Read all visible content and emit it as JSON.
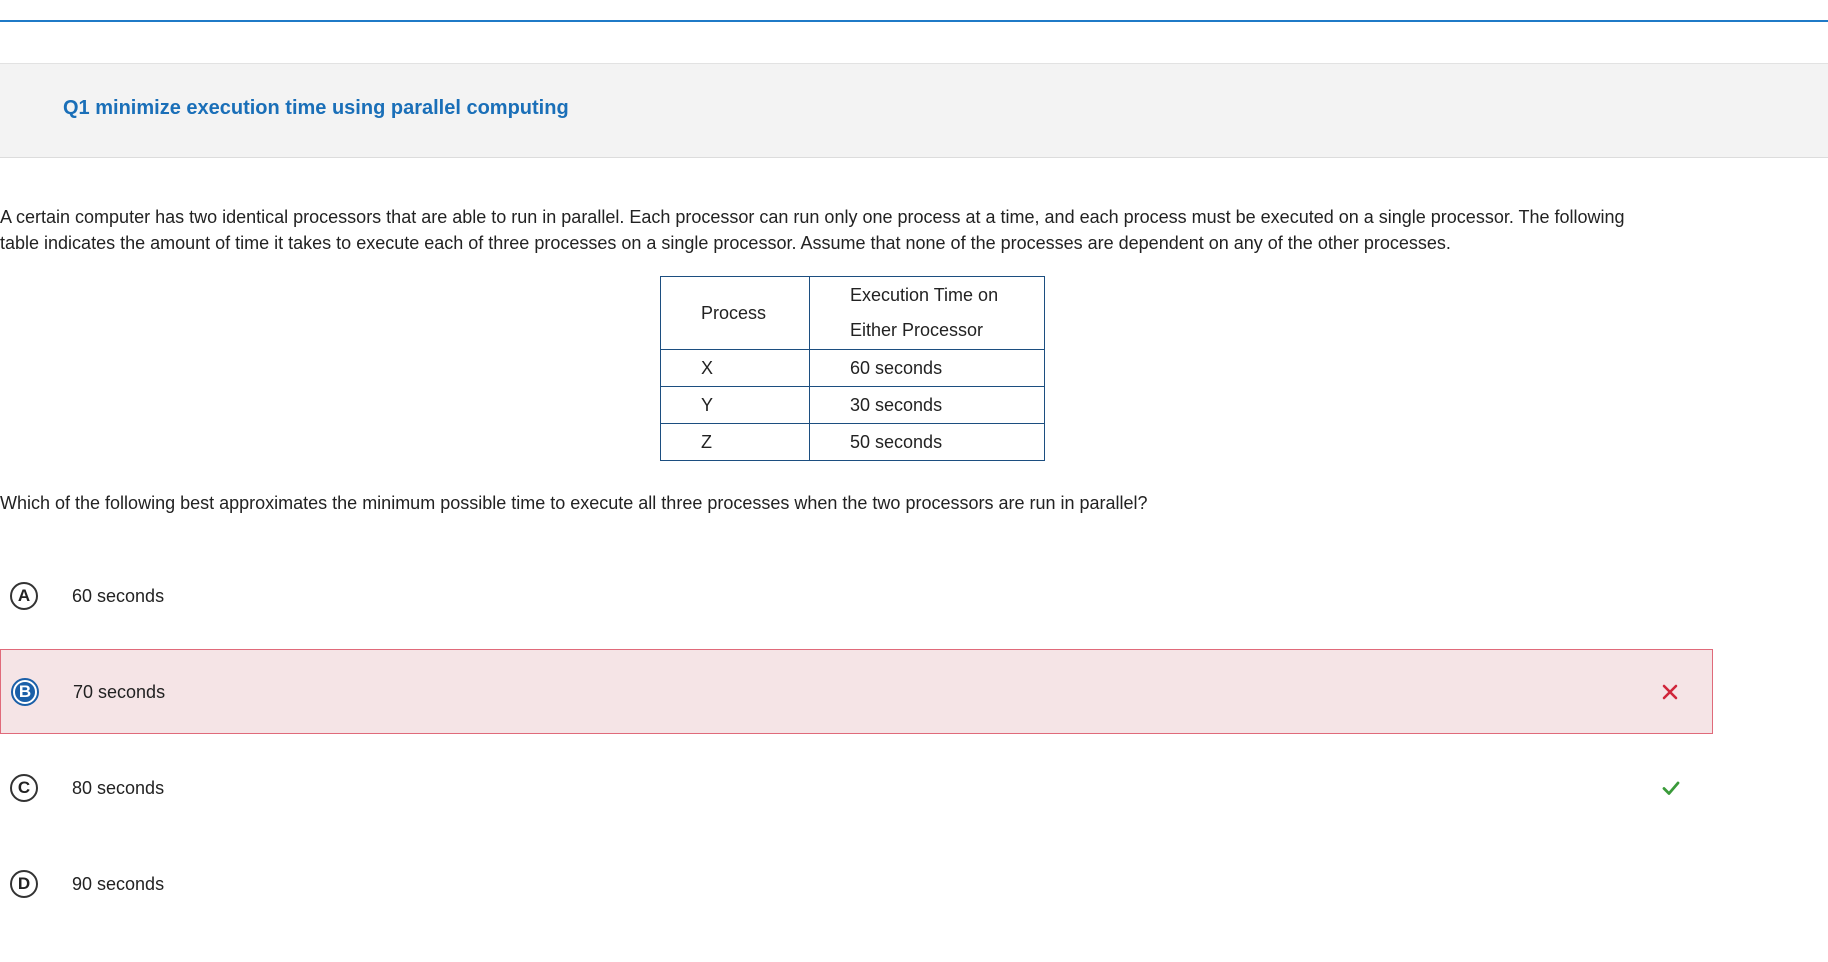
{
  "question": {
    "title": "Q1 minimize execution time using parallel computing",
    "prompt_line1": "A certain computer has two identical processors that are able to run in parallel. Each processor can run only one process at a time, and each process must be executed on a single processor. The following",
    "prompt_line2": "table indicates the amount of time it takes to execute each of three processes on a single processor. Assume that none of the processes are dependent on any of the other processes.",
    "stem": "Which of the following best approximates the minimum possible time to execute all three processes when the two processors are run in parallel?"
  },
  "table": {
    "header_process": "Process",
    "header_exec_line1": "Execution Time on",
    "header_exec_line2": "Either Processor",
    "rows": [
      {
        "process": "X",
        "time": "60 seconds"
      },
      {
        "process": "Y",
        "time": "30 seconds"
      },
      {
        "process": "Z",
        "time": "50 seconds"
      }
    ]
  },
  "choices": [
    {
      "letter": "A",
      "text": "60 seconds",
      "state": "none"
    },
    {
      "letter": "B",
      "text": "70 seconds",
      "state": "selected-incorrect"
    },
    {
      "letter": "C",
      "text": "80 seconds",
      "state": "correct"
    },
    {
      "letter": "D",
      "text": "90 seconds",
      "state": "none"
    }
  ],
  "icons": {
    "incorrect": "close-x-icon",
    "correct": "checkmark-icon"
  },
  "colors": {
    "accent": "#1a6fb8",
    "incorrect_bg": "#f5e4e6",
    "incorrect_border": "#e06a7a",
    "incorrect_mark": "#d0263b",
    "correct_mark": "#3a9a3a",
    "selected_letter": "#1a5fa8"
  }
}
